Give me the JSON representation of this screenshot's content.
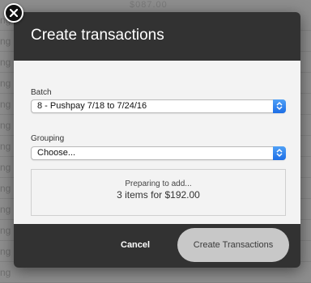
{
  "background": {
    "top_text": "$087.00",
    "row_label": "ng"
  },
  "modal": {
    "title": "Create transactions",
    "batch": {
      "label": "Batch",
      "value": "8 - Pushpay 7/18 to 7/24/16"
    },
    "grouping": {
      "label": "Grouping",
      "value": "Choose..."
    },
    "summary": {
      "line1": "Preparing to add...",
      "line2": "3 items for $192.00"
    },
    "footer": {
      "cancel_label": "Cancel",
      "create_label": "Create Transactions"
    }
  },
  "icons": {
    "close": "close-icon",
    "select_arrows": "up-down-chevron-icon"
  },
  "colors": {
    "header_bg": "#323232",
    "body_bg": "#f3f3f3",
    "select_arrow_blue": "#2b7cf0",
    "create_button_bg": "#c8c8c8"
  }
}
